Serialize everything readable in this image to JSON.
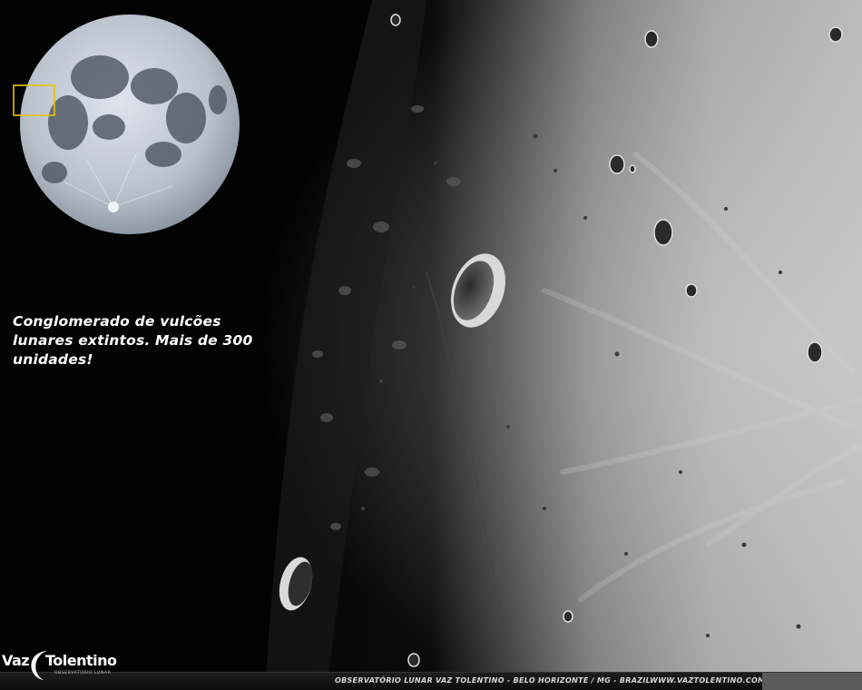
{
  "caption": {
    "line1": "Conglomerado de vulcões",
    "line2": "lunares extintos. Mais de 300",
    "line3": "unidades!"
  },
  "logo": {
    "word1": "Vaz",
    "word2": "Tolentino",
    "subtitle": "OBSERVATÓRIO LUNAR"
  },
  "footer": {
    "observatory": "OBSERVATÓRIO LUNAR VAZ TOLENTINO - BELO HORIZONTE / MG - BRAZIL",
    "website": "WWW.VAZTOLENTINO.COM"
  },
  "colors": {
    "highlight_box": "#e8c400",
    "moon_surface": "#9a9a9a",
    "sky": "#020202"
  }
}
